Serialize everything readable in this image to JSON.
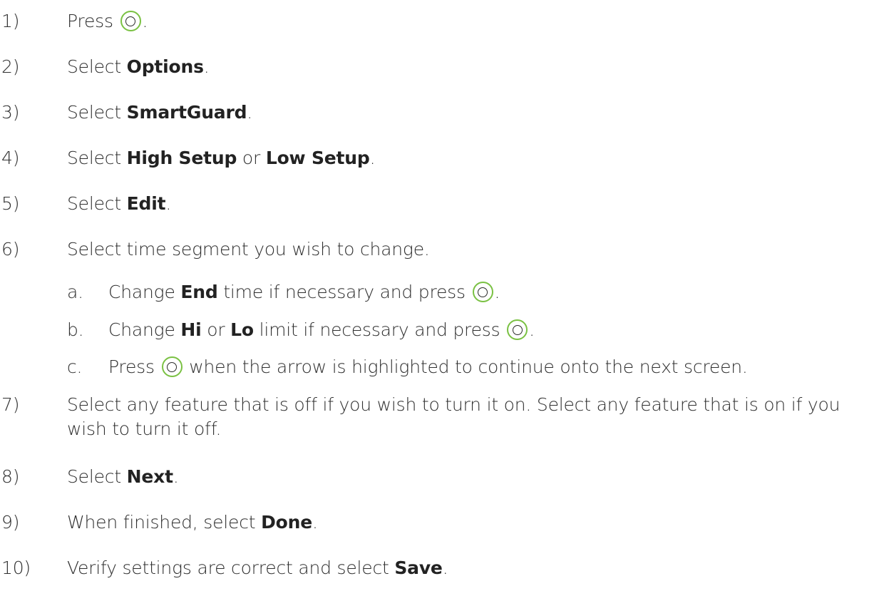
{
  "steps": [
    {
      "num": "1)",
      "parts": [
        "Press ",
        "",
        "."
      ]
    },
    {
      "num": "2)",
      "parts": [
        "Select ",
        "Options",
        "."
      ]
    },
    {
      "num": "3)",
      "parts": [
        "Select ",
        "SmartGuard",
        "."
      ]
    },
    {
      "num": "4)",
      "parts": [
        "Select ",
        "High Setup",
        " or ",
        "Low Setup",
        "."
      ]
    },
    {
      "num": "5)",
      "parts": [
        "Select ",
        "Edit",
        "."
      ]
    },
    {
      "num": "6)",
      "text": "Select time segment you wish to change."
    },
    {
      "num": "a.",
      "parts": [
        "Change ",
        "End",
        " time if necessary and press ",
        "",
        "."
      ]
    },
    {
      "num": "b.",
      "parts": [
        "Change ",
        "Hi",
        " or ",
        "Lo",
        " limit if necessary and press ",
        "",
        "."
      ]
    },
    {
      "num": "c.",
      "parts": [
        "Press ",
        "",
        " when the arrow is highlighted to continue onto the next screen."
      ]
    },
    {
      "num": "7)",
      "text": "Select any feature that is off if you wish to turn it on. Select any feature that is on if you wish to turn it off."
    },
    {
      "num": "8)",
      "parts": [
        "Select ",
        "Next",
        "."
      ]
    },
    {
      "num": "9)",
      "parts": [
        "When finished, select ",
        "Done",
        "."
      ]
    },
    {
      "num": "10)",
      "parts": [
        "Verify settings are correct and select ",
        "Save",
        "."
      ]
    }
  ],
  "icons": {
    "select_button": "select-button-icon",
    "accent": "#7ac143"
  }
}
